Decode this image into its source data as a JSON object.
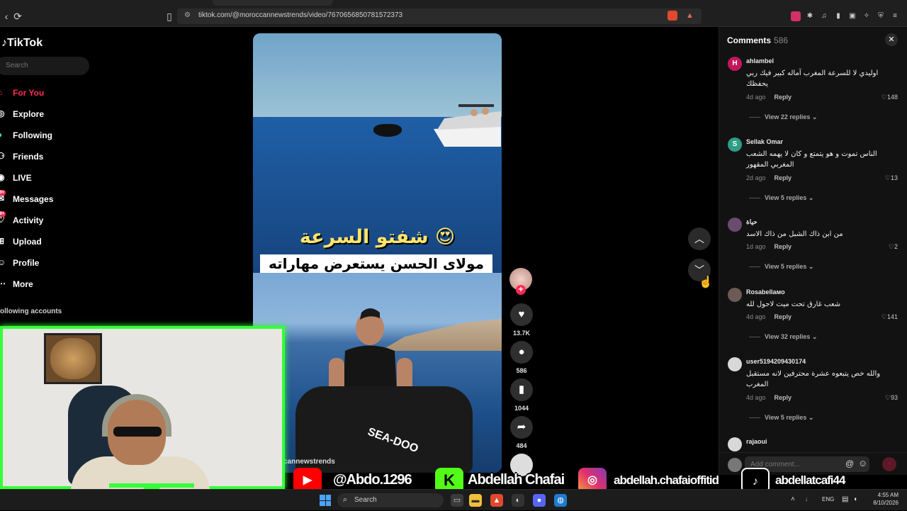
{
  "browser": {
    "url": "tiktok.com/@moroccannewstrends/video/7670656850781572373",
    "icons": [
      "back-icon",
      "reload-icon",
      "bookmark-icon",
      "site-settings-icon",
      "brave-shields-icon",
      "rewards-icon",
      "extensions-icon",
      "sidebar-icon",
      "wallet-icon",
      "vpn-icon",
      "menu-icon"
    ]
  },
  "sidebar": {
    "logo": "TikTok",
    "search_placeholder": "Search",
    "items": [
      {
        "label": "For You",
        "icon": "home-icon",
        "active": true
      },
      {
        "label": "Explore",
        "icon": "compass-icon"
      },
      {
        "label": "Following",
        "icon": "following-icon"
      },
      {
        "label": "Friends",
        "icon": "friends-icon"
      },
      {
        "label": "LIVE",
        "icon": "live-icon"
      },
      {
        "label": "Messages",
        "icon": "messages-icon",
        "badge": "9+"
      },
      {
        "label": "Activity",
        "icon": "activity-icon",
        "badge": "9+"
      },
      {
        "label": "Upload",
        "icon": "upload-icon"
      },
      {
        "label": "Profile",
        "icon": "profile-icon"
      },
      {
        "label": "More",
        "icon": "more-icon"
      }
    ],
    "following_title": "ollowing accounts"
  },
  "video": {
    "caption_line1": "شفتو السرعة 😍",
    "caption_line2": "مولاى الحسن يستعرض مهاراته",
    "jetski_brand": "SEA-DOO",
    "author_handle_partial": "cannewstrends"
  },
  "actions": {
    "likes": "13.7K",
    "comments": "586",
    "saves": "1044",
    "shares": "484"
  },
  "comments_panel": {
    "title": "Comments",
    "count": "586",
    "add_placeholder": "Add comment...",
    "list": [
      {
        "user": "ahlambel",
        "avatar": "H",
        "avatar_color": "#c2185b",
        "text": "اوليدي لا للسرعة المغرب آماله كبير فيك ربي يحفظك",
        "age": "4d ago",
        "likes": "148",
        "replies": "View 22 replies"
      },
      {
        "user": "Sellak Omar",
        "avatar": "S",
        "avatar_color": "#2e9e86",
        "text": "الناس تموت و هو يتمتع و كان لا يهمه الشعب المغربي المقهور",
        "age": "2d ago",
        "likes": "13",
        "replies": "View 5 replies"
      },
      {
        "user": "حياة",
        "avatar": "",
        "avatar_color": "#6a4c6e",
        "text": "من ابن ذاك الشبل من ذاك الاسد",
        "age": "1d ago",
        "likes": "2",
        "replies": "View 5 replies"
      },
      {
        "user": "Rosabellaᴍᴏ",
        "avatar": "",
        "avatar_color": "#6b5a55",
        "text": "شعب غارق تحت ميت لاحول لله",
        "age": "4d ago",
        "likes": "141",
        "replies": "View 32 replies"
      },
      {
        "user": "user5194209430174",
        "avatar": "",
        "avatar_color": "#d8d8d8",
        "text": "والله خص يتبعوه عشرة محترفين لانه مستقبل المغرب",
        "age": "4d ago",
        "likes": "93",
        "replies": "View 5 replies"
      },
      {
        "user": "rajaoui",
        "avatar": "",
        "avatar_color": "#d8d8d8",
        "text": "",
        "age": "",
        "likes": "",
        "replies": ""
      }
    ],
    "reply_label": "Reply"
  },
  "overlay": {
    "youtube": "@Abdo.1296",
    "kick": "Abdellah Chafai",
    "instagram": "abdellah.chafaioffitid",
    "tiktok": "abdellatcafi44",
    "colors": {
      "green": "#35ff3a",
      "youtube": "#ff0000",
      "kick": "#53fc18"
    }
  },
  "taskbar": {
    "search_label": "Search",
    "lang": "ENG",
    "time": "4:55 AM",
    "date": "8/10/2026"
  }
}
